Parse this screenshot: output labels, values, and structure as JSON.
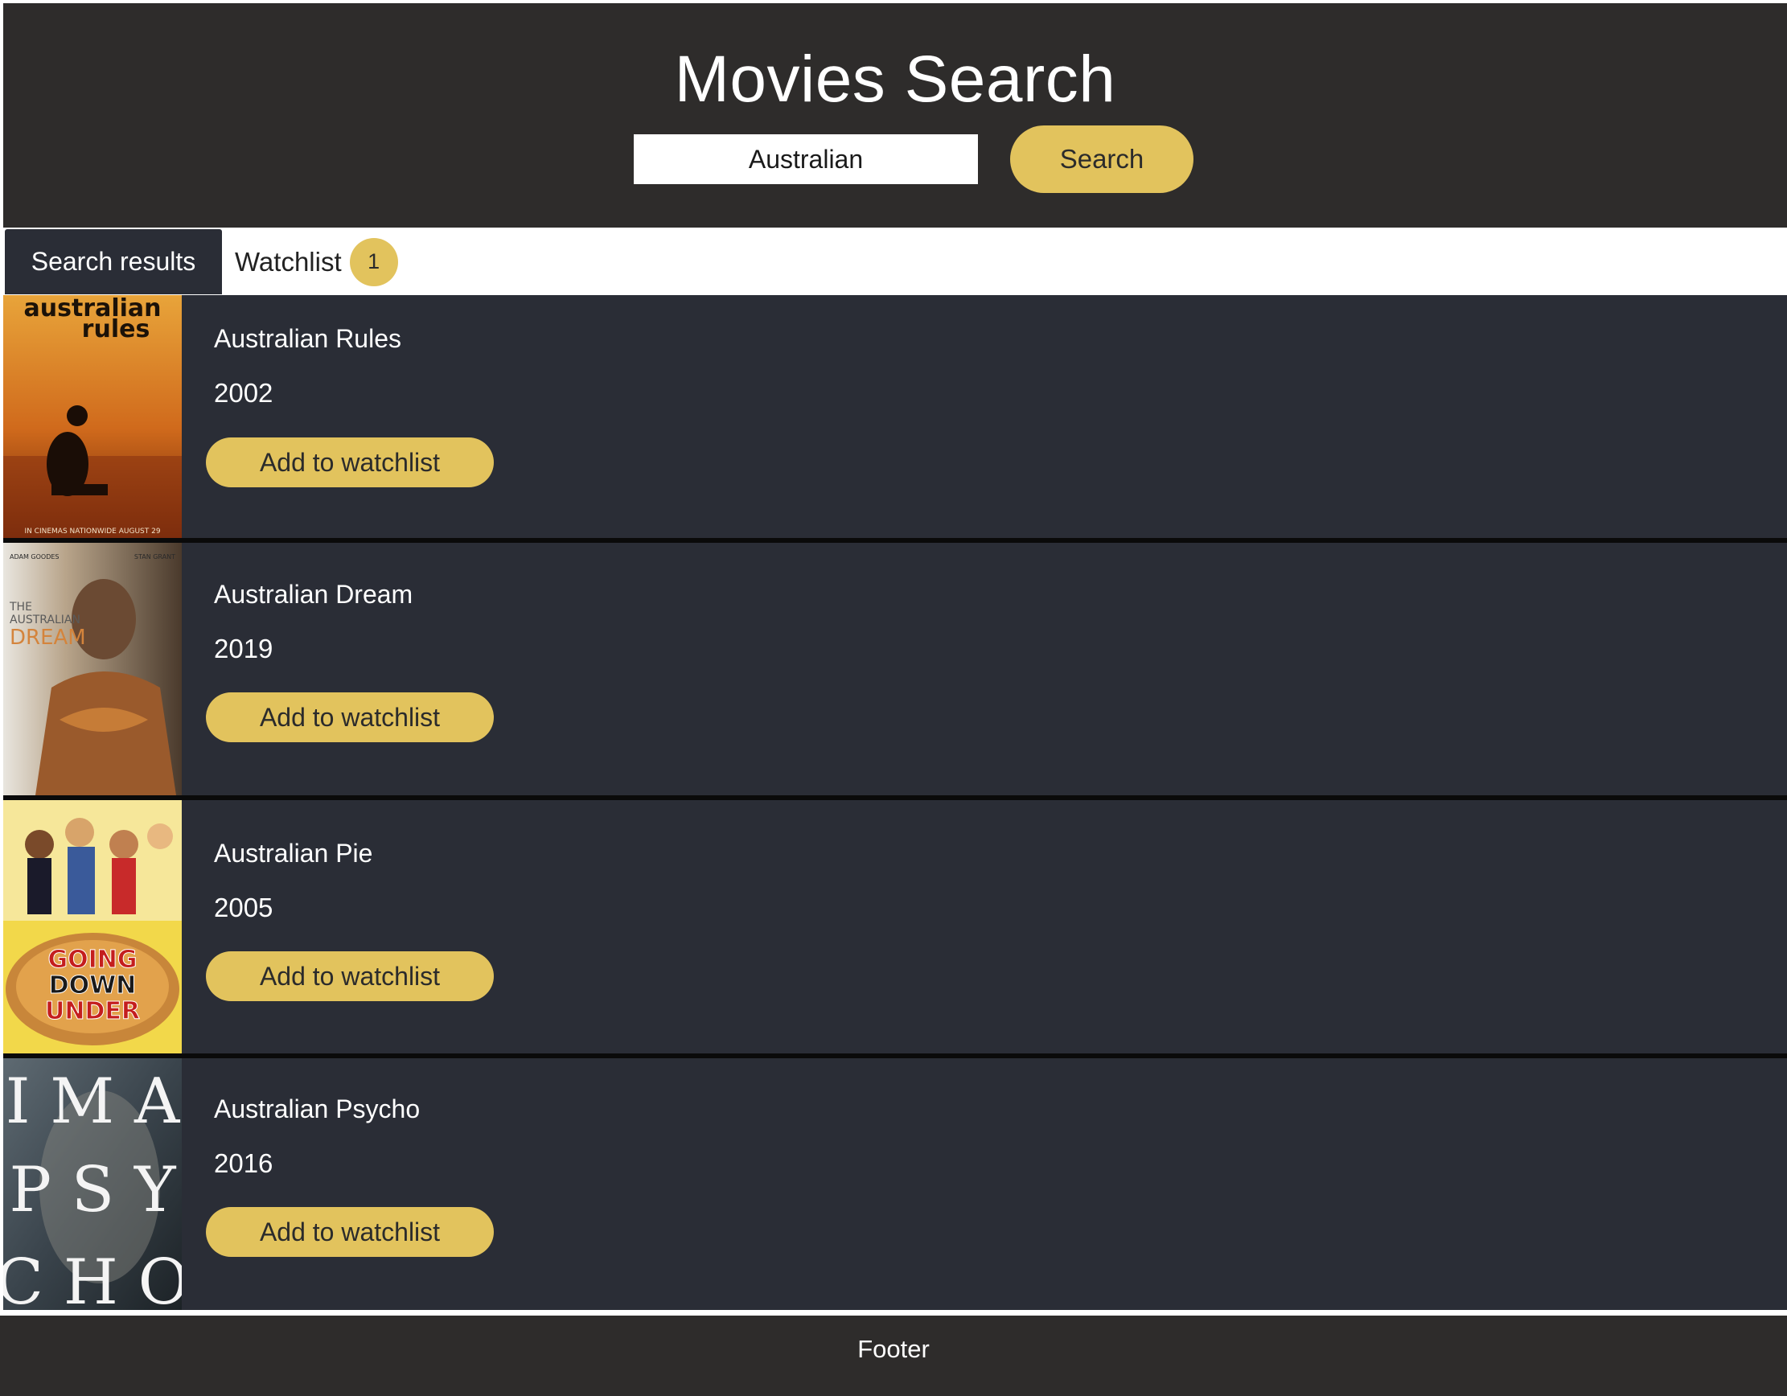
{
  "header": {
    "title": "Movies Search",
    "search_value": "Australian",
    "search_button": "Search"
  },
  "tabs": {
    "search_results": "Search results",
    "watchlist": "Watchlist",
    "watchlist_count": "1"
  },
  "movies": [
    {
      "title": "Australian Rules",
      "year": "2002",
      "button": "Add to watchlist",
      "poster_text": [
        "australian",
        "rules",
        "IN CINEMAS NATIONWIDE AUGUST 29"
      ]
    },
    {
      "title": "Australian Dream",
      "year": "2019",
      "button": "Add to watchlist",
      "poster_text": [
        "ADAM GOODES",
        "STAN GRANT",
        "THE",
        "AUSTRALIAN",
        "DREAM"
      ]
    },
    {
      "title": "Australian Pie",
      "year": "2005",
      "button": "Add to watchlist",
      "poster_text": [
        "GOING",
        "DOWN",
        "UNDER"
      ]
    },
    {
      "title": "Australian Psycho",
      "year": "2016",
      "button": "Add to watchlist",
      "poster_text": [
        "I M A",
        "P S Y",
        "C H O"
      ]
    }
  ],
  "footer": {
    "text": "Footer"
  },
  "colors": {
    "header_bg": "#2e2c2b",
    "card_bg": "#2a2d36",
    "accent": "#e2c35d"
  }
}
